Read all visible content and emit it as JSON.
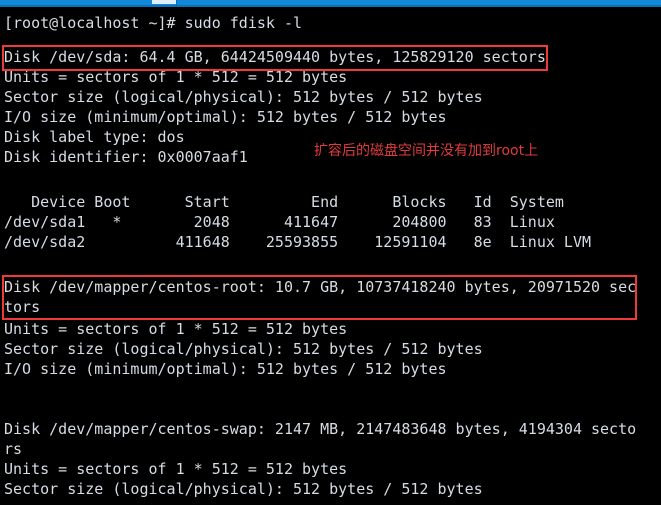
{
  "window": {
    "titlebar_color": "#1289d8",
    "tab_indicator_color": "#dfeef9"
  },
  "terminal": {
    "background": "#000000",
    "foreground": "#d6dce4",
    "annotation_color": "#f03a3a",
    "prompt": "[root@localhost ~]# sudo fdisk -l",
    "lines": [
      "Disk /dev/sda: 64.4 GB, 64424509440 bytes, 125829120 sectors",
      "Units = sectors of 1 * 512 = 512 bytes",
      "Sector size (logical/physical): 512 bytes / 512 bytes",
      "I/O size (minimum/optimal): 512 bytes / 512 bytes",
      "Disk label type: dos",
      "Disk identifier: 0x0007aaf1",
      "",
      "   Device Boot      Start         End      Blocks   Id  System",
      "/dev/sda1   *        2048      411647      204800   83  Linux",
      "/dev/sda2          411648    25593855    12591104   8e  Linux LVM",
      "",
      "Disk /dev/mapper/centos-root: 10.7 GB, 10737418240 bytes, 20971520 sec",
      "tors",
      "Units = sectors of 1 * 512 = 512 bytes",
      "Sector size (logical/physical): 512 bytes / 512 bytes",
      "I/O size (minimum/optimal): 512 bytes / 512 bytes",
      "",
      "",
      "Disk /dev/mapper/centos-swap: 2147 MB, 2147483648 bytes, 4194304 secto",
      "rs",
      "Units = sectors of 1 * 512 = 512 bytes",
      "Sector size (logical/physical): 512 bytes / 512 bytes"
    ],
    "annotation_note": "扩容后的磁盘空间并没有加到root上"
  },
  "disks": [
    {
      "device": "/dev/sda",
      "size_human": "64.4 GB",
      "size_bytes": "64424509440",
      "sectors": "125829120",
      "units": "sectors of 1 * 512 = 512 bytes",
      "sector_size": "512 bytes / 512 bytes",
      "io_size": "512 bytes / 512 bytes",
      "label_type": "dos",
      "identifier": "0x0007aaf1",
      "highlighted": true
    },
    {
      "device": "/dev/mapper/centos-root",
      "size_human": "10.7 GB",
      "size_bytes": "10737418240",
      "sectors": "20971520",
      "units": "sectors of 1 * 512 = 512 bytes",
      "sector_size": "512 bytes / 512 bytes",
      "io_size": "512 bytes / 512 bytes",
      "highlighted": true
    },
    {
      "device": "/dev/mapper/centos-swap",
      "size_human": "2147 MB",
      "size_bytes": "2147483648",
      "sectors": "4194304",
      "units": "sectors of 1 * 512 = 512 bytes",
      "sector_size": "512 bytes / 512 bytes",
      "highlighted": false
    }
  ],
  "partition_table": {
    "headers": [
      "Device",
      "Boot",
      "Start",
      "End",
      "Blocks",
      "Id",
      "System"
    ],
    "rows": [
      {
        "device": "/dev/sda1",
        "boot": "*",
        "start": "2048",
        "end": "411647",
        "blocks": "204800",
        "id": "83",
        "system": "Linux"
      },
      {
        "device": "/dev/sda2",
        "boot": "",
        "start": "411648",
        "end": "25593855",
        "blocks": "12591104",
        "id": "8e",
        "system": "Linux LVM"
      }
    ]
  }
}
